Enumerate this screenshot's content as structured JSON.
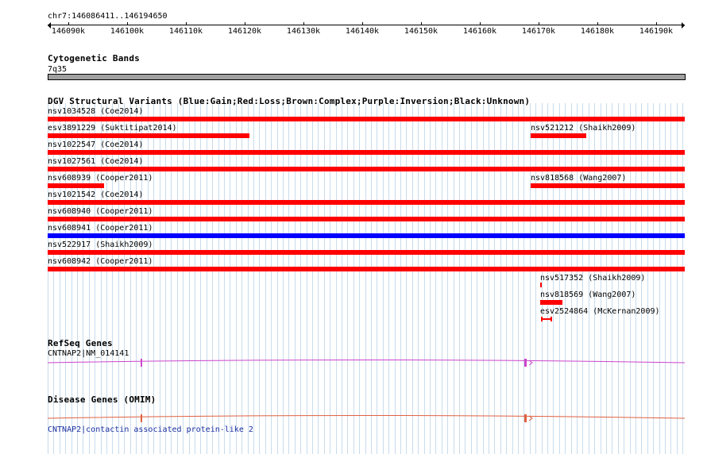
{
  "locus": "chr7:146086411..146194650",
  "ruler": {
    "ticks": [
      "146090k",
      "146100k",
      "146110k",
      "146120k",
      "146130k",
      "146140k",
      "146150k",
      "146160k",
      "146170k",
      "146180k",
      "146190k"
    ]
  },
  "tracks": {
    "cytoband": {
      "title": "Cytogenetic Bands",
      "band": "7q35"
    },
    "dgv": {
      "title": "DGV Structural Variants (Blue:Gain;Red:Loss;Brown:Complex;Purple:Inversion;Black:Unknown)",
      "features": [
        {
          "label": "nsv1034528 (Coe2014)",
          "type": "loss"
        },
        {
          "label": "esv3891229 (Suktitipat2014)",
          "type": "loss"
        },
        {
          "label": "nsv521212 (Shaikh2009)",
          "type": "loss"
        },
        {
          "label": "nsv1022547 (Coe2014)",
          "type": "loss"
        },
        {
          "label": "nsv1027561 (Coe2014)",
          "type": "loss"
        },
        {
          "label": "nsv608939 (Cooper2011)",
          "type": "loss"
        },
        {
          "label": "nsv818568 (Wang2007)",
          "type": "loss"
        },
        {
          "label": "nsv1021542 (Coe2014)",
          "type": "loss"
        },
        {
          "label": "nsv608940 (Cooper2011)",
          "type": "loss"
        },
        {
          "label": "nsv608941 (Cooper2011)",
          "type": "gain"
        },
        {
          "label": "nsv522917 (Shaikh2009)",
          "type": "loss"
        },
        {
          "label": "nsv608942 (Cooper2011)",
          "type": "loss"
        },
        {
          "label": "nsv517352 (Shaikh2009)",
          "type": "loss"
        },
        {
          "label": "nsv818569 (Wang2007)",
          "type": "loss"
        },
        {
          "label": "esv2524864 (McKernan2009)",
          "type": "loss"
        }
      ]
    },
    "refseq": {
      "title": "RefSeq Genes",
      "gene_label": "CNTNAP2|NM_014141"
    },
    "omim": {
      "title": "Disease Genes (OMIM)",
      "gene_label": "CNTNAP2|contactin associated protein-like 2"
    }
  },
  "colors": {
    "loss": "#ff0000",
    "gain": "#0000ff",
    "grid": "#c8dcec",
    "refseq": "#cc44cc",
    "omim": "#e06040",
    "omim_text": "#1a2fa0",
    "cytoband": "#a0a0a0"
  }
}
